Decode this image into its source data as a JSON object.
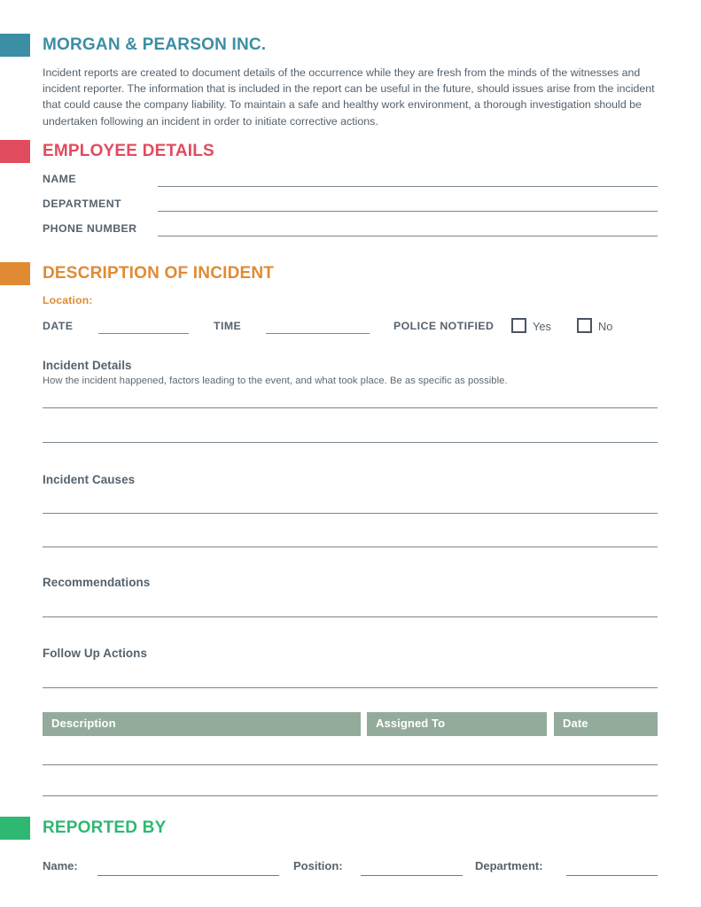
{
  "document": {
    "company_title": "MORGAN & PEARSON INC.",
    "intro_paragraph": "Incident reports are created to document details of the occurrence while they are fresh from the minds of the witnesses and incident reporter. The information that is included in the report can be useful in the future, should issues arise from the incident that could cause the company liability. To maintain a safe and healthy work environment, a thorough investigation should be undertaken following an incident in order to initiate corrective actions."
  },
  "colors": {
    "teal": "#3c8ea5",
    "red": "#e14b5e",
    "orange": "#e08b33",
    "green": "#2eb872",
    "table_header": "#93ab9b",
    "rule": "#7b868f"
  },
  "employee_details": {
    "heading": "EMPLOYEE DETAILS",
    "fields": [
      {
        "label": "NAME",
        "value": ""
      },
      {
        "label": "DEPARTMENT",
        "value": ""
      },
      {
        "label": "PHONE NUMBER",
        "value": ""
      }
    ]
  },
  "description_of_incident": {
    "heading": "DESCRIPTION OF INCIDENT",
    "location_label": "Location:",
    "location_value": "",
    "date_label": "DATE",
    "date_value": "",
    "time_label": "TIME",
    "time_value": "",
    "police_notified_label": "POLICE NOTIFIED",
    "police_yes_label": "Yes",
    "police_no_label": "No",
    "police_yes_checked": false,
    "police_no_checked": false,
    "subsections": [
      {
        "heading": "Incident Details",
        "note": "How the incident happened, factors leading to the event, and what took place. Be as specific as possible.",
        "lines": 2
      },
      {
        "heading": "Incident Causes",
        "note": "",
        "lines": 2
      },
      {
        "heading": "Recommendations",
        "note": "",
        "lines": 1
      },
      {
        "heading": "Follow Up Actions",
        "note": "",
        "lines": 1
      }
    ]
  },
  "action_table": {
    "columns": [
      "Description",
      "Assigned To",
      "Date"
    ],
    "rows": [
      {
        "description": "",
        "assigned_to": "",
        "date": ""
      },
      {
        "description": "",
        "assigned_to": "",
        "date": ""
      }
    ]
  },
  "reported_by": {
    "heading": "REPORTED BY",
    "fields": [
      {
        "label": "Name:",
        "value": ""
      },
      {
        "label": "Position:",
        "value": ""
      },
      {
        "label": "Department:",
        "value": ""
      }
    ]
  }
}
